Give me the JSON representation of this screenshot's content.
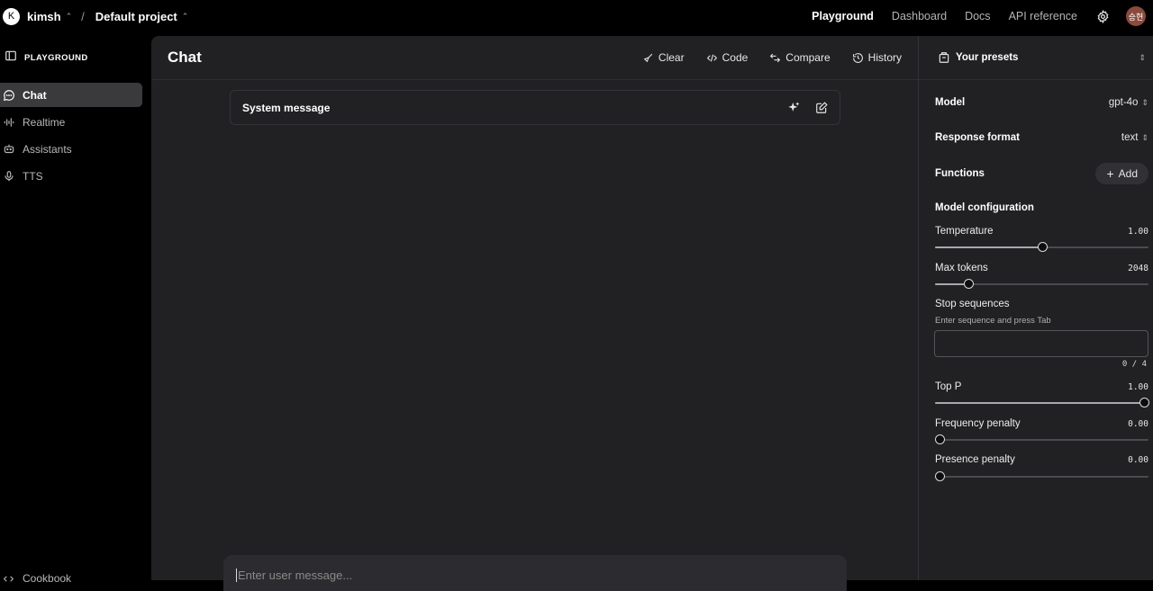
{
  "topbar": {
    "org_initial": "K",
    "org_name": "kimsh",
    "project_name": "Default project",
    "nav": [
      "Playground",
      "Dashboard",
      "Docs",
      "API reference"
    ],
    "active_nav": "Playground",
    "user_initials": "승현"
  },
  "sidebar": {
    "section_label": "PLAYGROUND",
    "items": [
      {
        "label": "Chat",
        "icon": "chat-bubble-icon",
        "active": true
      },
      {
        "label": "Realtime",
        "icon": "waveform-icon",
        "active": false
      },
      {
        "label": "Assistants",
        "icon": "robot-icon",
        "active": false
      },
      {
        "label": "TTS",
        "icon": "microphone-icon",
        "active": false
      }
    ],
    "footer_label": "Cookbook"
  },
  "main": {
    "title": "Chat",
    "toolbar": {
      "clear": "Clear",
      "code": "Code",
      "compare": "Compare",
      "history": "History"
    },
    "system_message_label": "System message",
    "composer_placeholder": "Enter user message..."
  },
  "right": {
    "presets_label": "Your presets",
    "model_label": "Model",
    "model_value": "gpt-4o",
    "response_format_label": "Response format",
    "response_format_value": "text",
    "functions_label": "Functions",
    "add_label": "Add",
    "model_config_label": "Model configuration",
    "temperature": {
      "label": "Temperature",
      "value": "1.00",
      "fraction": 0.5
    },
    "max_tokens": {
      "label": "Max tokens",
      "value": "2048",
      "fraction": 0.14
    },
    "stop_sequences": {
      "label": "Stop sequences",
      "hint": "Enter sequence and press Tab",
      "counter": "0 / 4"
    },
    "top_p": {
      "label": "Top P",
      "value": "1.00",
      "fraction": 1.0
    },
    "frequency_penalty": {
      "label": "Frequency penalty",
      "value": "0.00",
      "fraction": 0.0
    },
    "presence_penalty": {
      "label": "Presence penalty",
      "value": "0.00",
      "fraction": 0.0
    }
  }
}
